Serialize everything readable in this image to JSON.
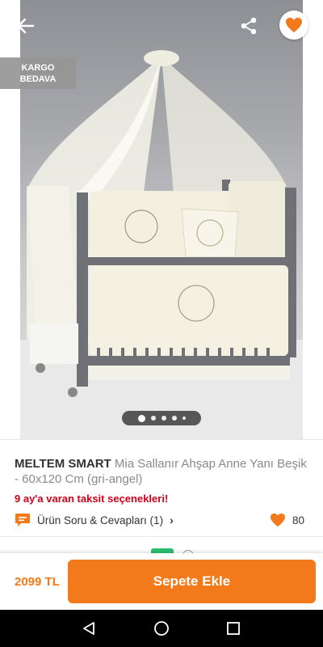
{
  "header": {
    "back_icon": "arrow-left-icon",
    "share_icon": "share-icon",
    "favorite_icon": "heart-icon",
    "favorited": true
  },
  "product_image": {
    "badge_line1": "KARGO",
    "badge_line2": "BEDAVA",
    "image_count": 5,
    "active_image": 1
  },
  "product": {
    "brand": "MELTEM SMART",
    "name": "Mia Sallanır Ahşap Anne Yanı Beşik - 60x120 Cm (gri-angel)",
    "installment_text": "9 ay'a varan taksit seçenekleri!",
    "qa_label": "Ürün Soru & Cevapları (1)",
    "favorite_count": "80"
  },
  "action_bar": {
    "price": "2099 TL",
    "add_to_cart_label": "Sepete Ekle"
  },
  "colors": {
    "accent": "#f27a1a",
    "installment": "#d0021b",
    "badge_bg": "#969696"
  }
}
